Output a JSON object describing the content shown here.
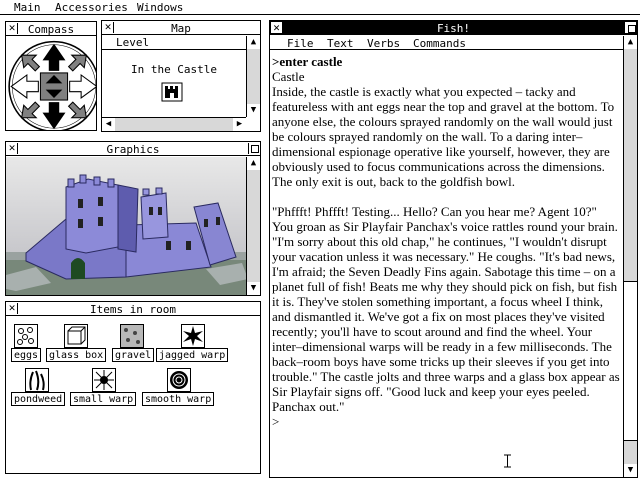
{
  "menubar": {
    "items": [
      "Main",
      "Accessories",
      "Windows"
    ]
  },
  "compass": {
    "title": "Compass",
    "close_glyph": "✕"
  },
  "map": {
    "title": "Map",
    "close_glyph": "✕",
    "level_label": "Level",
    "place": "In the Castle"
  },
  "graphics": {
    "title": "Graphics",
    "close_glyph": "✕"
  },
  "items_room": {
    "title": "Items in room",
    "close_glyph": "✕",
    "items": [
      "eggs",
      "glass box",
      "gravel",
      "jagged warp",
      "pondweed",
      "small warp",
      "smooth warp"
    ]
  },
  "fish": {
    "title": "Fish!",
    "close_glyph": "✕",
    "menu": [
      "File",
      "Text",
      "Verbs",
      "Commands"
    ],
    "command": ">enter castle",
    "room": "Castle",
    "para1": "Inside, the castle is exactly what you expected – tacky and featureless with ant eggs near the top and gravel at the bottom. To anyone else, the colours sprayed randomly on the wall would just be colours sprayed randomly on the wall. To a daring inter–dimensional espionage operative like yourself, however, they are obviously used to focus communications across the dimensions. The only exit is out, back to the goldfish bowl.",
    "para2": "\"Phffft! Phffft! Testing... Hello? Can you hear me? Agent 10?\" You groan as Sir Playfair Panchax's voice rattles round your brain. \"I'm sorry about this old chap,\" he continues, \"I wouldn't disrupt your vacation unless it was necessary.\" He coughs. \"It's bad news, I'm afraid; the Seven Deadly Fins again. Sabotage this time – on a planet full of fish! Beats me why they should pick on fish, but fish it is. They've stolen something important, a focus wheel I think, and dismantled it. We've got a fix on most places they've visited recently; you'll have to scout around and find the wheel. Your inter–dimensional warps will be ready in a few milliseconds. The back–room boys have some tricks up their sleeves if you get into trouble.\" The castle jolts and three warps and a glass box appear as Sir Playfair signs off. \"Good luck and keep your eyes peeled. Panchax out.\"",
    "prompt": ">"
  }
}
